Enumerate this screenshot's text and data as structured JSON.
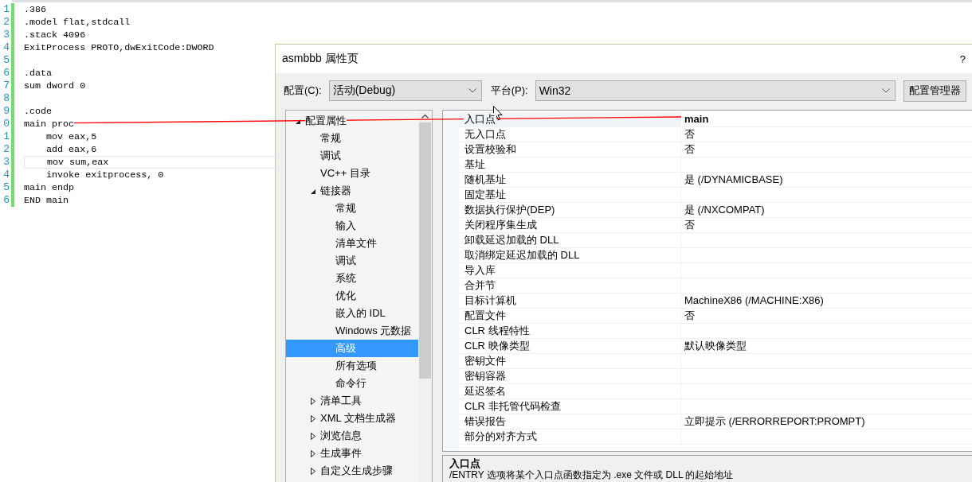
{
  "editor": {
    "lines": [
      {
        "number": "1",
        "text": ".386",
        "current": false
      },
      {
        "number": "2",
        "text": ".model flat,stdcall",
        "current": false
      },
      {
        "number": "3",
        "text": ".stack 4096",
        "current": false
      },
      {
        "number": "4",
        "text": "ExitProcess PROTO,dwExitCode:DWORD",
        "current": false
      },
      {
        "number": "5",
        "current": false
      },
      {
        "number": "6",
        "text": ".data",
        "current": false
      },
      {
        "number": "7",
        "text": "sum dword 0",
        "current": false
      },
      {
        "number": "8",
        "current": false
      },
      {
        "number": "9",
        "text": ".code",
        "current": false
      },
      {
        "number": "0",
        "text": "main proc",
        "current": false
      },
      {
        "number": "1",
        "text": "    mov eax,5",
        "current": false
      },
      {
        "number": "2",
        "text": "    add eax,6",
        "current": false
      },
      {
        "number": "3",
        "text": "    mov sum,eax",
        "current": true
      },
      {
        "number": "4",
        "text": "    invoke exitprocess, 0",
        "current": false
      },
      {
        "number": "5",
        "text": "main endp",
        "current": false
      },
      {
        "number": "6",
        "text": "END main",
        "current": false
      }
    ]
  },
  "dialog": {
    "title": "asmbbb 属性页",
    "help": "?",
    "configuration": {
      "label": "配置(C):",
      "value": "活动(Debug)"
    },
    "platform": {
      "label": "平台(P):",
      "value": "Win32"
    },
    "manager_button": "配置管理器",
    "tree": [
      {
        "label": "配置属性",
        "kind": "group",
        "expanded": true,
        "selected": false,
        "children": [
          {
            "label": "常规",
            "kind": "page",
            "selected": false
          },
          {
            "label": "调试",
            "kind": "page",
            "selected": false
          },
          {
            "label": "VC++ 目录",
            "kind": "page",
            "selected": false
          },
          {
            "label": "链接器",
            "kind": "group",
            "expanded": true,
            "selected": false,
            "children": [
              {
                "label": "常规",
                "kind": "page",
                "selected": false
              },
              {
                "label": "输入",
                "kind": "page",
                "selected": false
              },
              {
                "label": "清单文件",
                "kind": "page",
                "selected": false
              },
              {
                "label": "调试",
                "kind": "page",
                "selected": false
              },
              {
                "label": "系统",
                "kind": "page",
                "selected": false
              },
              {
                "label": "优化",
                "kind": "page",
                "selected": false
              },
              {
                "label": "嵌入的 IDL",
                "kind": "page",
                "selected": false
              },
              {
                "label": "Windows 元数据",
                "kind": "page",
                "selected": false
              },
              {
                "label": "高级",
                "kind": "page",
                "selected": true
              },
              {
                "label": "所有选项",
                "kind": "page",
                "selected": false
              },
              {
                "label": "命令行",
                "kind": "page",
                "selected": false
              }
            ]
          },
          {
            "label": "清单工具",
            "kind": "group",
            "expanded": false,
            "selected": false
          },
          {
            "label": "XML 文档生成器",
            "kind": "group",
            "expanded": false,
            "selected": false
          },
          {
            "label": "浏览信息",
            "kind": "group",
            "expanded": false,
            "selected": false
          },
          {
            "label": "生成事件",
            "kind": "group",
            "expanded": false,
            "selected": false
          },
          {
            "label": "自定义生成步骤",
            "kind": "group",
            "expanded": false,
            "selected": false
          }
        ]
      }
    ],
    "properties": [
      {
        "name": "入口点",
        "value": "main",
        "selected": true,
        "modified": true
      },
      {
        "name": "无入口点",
        "value": "否",
        "selected": false,
        "modified": false
      },
      {
        "name": "设置校验和",
        "value": "否",
        "selected": false,
        "modified": false
      },
      {
        "name": "基址",
        "selected": false
      },
      {
        "name": "随机基址",
        "value": "是 (/DYNAMICBASE)",
        "selected": false,
        "modified": false
      },
      {
        "name": "固定基址",
        "selected": false
      },
      {
        "name": "数据执行保护(DEP)",
        "value": "是 (/NXCOMPAT)",
        "selected": false,
        "modified": false
      },
      {
        "name": "关闭程序集生成",
        "value": "否",
        "selected": false,
        "modified": false
      },
      {
        "name": "卸载延迟加载的 DLL",
        "selected": false
      },
      {
        "name": "取消绑定延迟加载的 DLL",
        "selected": false
      },
      {
        "name": "导入库",
        "selected": false
      },
      {
        "name": "合并节",
        "selected": false
      },
      {
        "name": "目标计算机",
        "value": "MachineX86 (/MACHINE:X86)",
        "selected": false,
        "modified": false
      },
      {
        "name": "配置文件",
        "value": "否",
        "selected": false,
        "modified": false
      },
      {
        "name": "CLR 线程特性",
        "selected": false
      },
      {
        "name": "CLR 映像类型",
        "value": "默认映像类型",
        "selected": false,
        "modified": false
      },
      {
        "name": "密钥文件",
        "selected": false
      },
      {
        "name": "密钥容器",
        "selected": false
      },
      {
        "name": "延迟签名",
        "selected": false
      },
      {
        "name": "CLR 非托管代码检查",
        "selected": false
      },
      {
        "name": "错误报告",
        "value": "立即提示 (/ERRORREPORT:PROMPT)",
        "selected": false,
        "modified": false
      },
      {
        "name": "部分的对齐方式",
        "selected": false
      }
    ],
    "description": {
      "title": "入口点",
      "text": "/ENTRY 选项将某个入口点函数指定为 .exe 文件或 DLL 的起始地址"
    }
  }
}
